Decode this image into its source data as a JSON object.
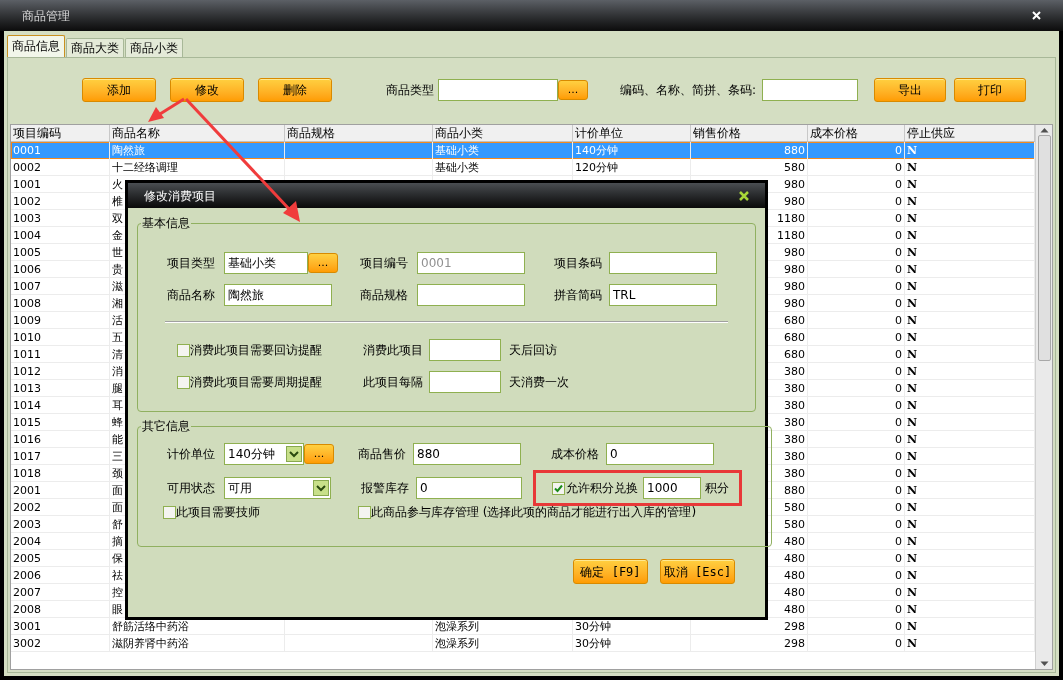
{
  "window": {
    "title": "商品管理"
  },
  "tabs": [
    {
      "label": "商品信息",
      "selected": true
    },
    {
      "label": "商品大类",
      "selected": false
    },
    {
      "label": "商品小类",
      "selected": false
    }
  ],
  "toolbar": {
    "buttons": [
      "添加",
      "修改",
      "删除"
    ],
    "type_label": "商品类型",
    "browse": "...",
    "search_label": "编码、名称、简拼、条码:",
    "right_buttons": [
      "导出",
      "打印"
    ]
  },
  "table": {
    "columns": [
      "项目编码",
      "商品名称",
      "商品规格",
      "商品小类",
      "计价单位",
      "销售价格",
      "成本价格",
      "停止供应"
    ],
    "rows": [
      {
        "code": "0001",
        "name": "陶然旅",
        "category": "基础小类",
        "unit": "140分钟",
        "price": "880",
        "cost": "0",
        "stop": "N",
        "selected": true
      },
      {
        "code": "0002",
        "name": "十二经络调理",
        "category": "基础小类",
        "unit": "120分钟",
        "price": "580",
        "cost": "0",
        "stop": "N",
        "selected": false
      },
      {
        "code": "1001",
        "name": "火",
        "price": "980",
        "cost": "0",
        "stop": "N",
        "selected": false
      },
      {
        "code": "1002",
        "name": "椎",
        "price": "980",
        "cost": "0",
        "stop": "N",
        "selected": false
      },
      {
        "code": "1003",
        "name": "双",
        "price": "1180",
        "cost": "0",
        "stop": "N",
        "selected": false
      },
      {
        "code": "1004",
        "name": "金",
        "price": "1180",
        "cost": "0",
        "stop": "N",
        "selected": false
      },
      {
        "code": "1005",
        "name": "世",
        "price": "980",
        "cost": "0",
        "stop": "N",
        "selected": false
      },
      {
        "code": "1006",
        "name": "贵",
        "price": "980",
        "cost": "0",
        "stop": "N",
        "selected": false
      },
      {
        "code": "1007",
        "name": "滋",
        "price": "980",
        "cost": "0",
        "stop": "N",
        "selected": false
      },
      {
        "code": "1008",
        "name": "湘",
        "price": "980",
        "cost": "0",
        "stop": "N",
        "selected": false
      },
      {
        "code": "1009",
        "name": "活",
        "price": "680",
        "cost": "0",
        "stop": "N",
        "selected": false
      },
      {
        "code": "1010",
        "name": "五",
        "price": "680",
        "cost": "0",
        "stop": "N",
        "selected": false
      },
      {
        "code": "1011",
        "name": "清",
        "price": "680",
        "cost": "0",
        "stop": "N",
        "selected": false
      },
      {
        "code": "1012",
        "name": "消",
        "price": "380",
        "cost": "0",
        "stop": "N",
        "selected": false
      },
      {
        "code": "1013",
        "name": "腿",
        "price": "380",
        "cost": "0",
        "stop": "N",
        "selected": false
      },
      {
        "code": "1014",
        "name": "耳",
        "price": "380",
        "cost": "0",
        "stop": "N",
        "selected": false
      },
      {
        "code": "1015",
        "name": "蜂",
        "price": "380",
        "cost": "0",
        "stop": "N",
        "selected": false
      },
      {
        "code": "1016",
        "name": "能",
        "price": "380",
        "cost": "0",
        "stop": "N",
        "selected": false
      },
      {
        "code": "1017",
        "name": "三",
        "price": "380",
        "cost": "0",
        "stop": "N",
        "selected": false
      },
      {
        "code": "1018",
        "name": "颈",
        "price": "380",
        "cost": "0",
        "stop": "N",
        "selected": false
      },
      {
        "code": "2001",
        "name": "面",
        "price": "880",
        "cost": "0",
        "stop": "N",
        "selected": false
      },
      {
        "code": "2002",
        "name": "面",
        "price": "580",
        "cost": "0",
        "stop": "N",
        "selected": false
      },
      {
        "code": "2003",
        "name": "舒",
        "price": "580",
        "cost": "0",
        "stop": "N",
        "selected": false
      },
      {
        "code": "2004",
        "name": "摘",
        "price": "480",
        "cost": "0",
        "stop": "N",
        "selected": false
      },
      {
        "code": "2005",
        "name": "保",
        "price": "480",
        "cost": "0",
        "stop": "N",
        "selected": false
      },
      {
        "code": "2006",
        "name": "祛",
        "price": "480",
        "cost": "0",
        "stop": "N",
        "selected": false
      },
      {
        "code": "2007",
        "name": "控",
        "price": "480",
        "cost": "0",
        "stop": "N",
        "selected": false
      },
      {
        "code": "2008",
        "name": "眼",
        "price": "480",
        "cost": "0",
        "stop": "N",
        "selected": false
      },
      {
        "code": "3001",
        "name": "舒筋活络中药浴",
        "category": "泡澡系列",
        "unit": "30分钟",
        "price": "298",
        "cost": "0",
        "stop": "N",
        "selected": false
      },
      {
        "code": "3002",
        "name": "滋阴养肾中药浴",
        "category": "泡澡系列",
        "unit": "30分钟",
        "price": "298",
        "cost": "0",
        "stop": "N",
        "selected": false
      }
    ]
  },
  "dialog": {
    "title": "修改消费项目",
    "basic": {
      "legend": "基本信息",
      "type": {
        "label": "项目类型",
        "value": "基础小类",
        "browse": "..."
      },
      "code": {
        "label": "项目编号",
        "value": "0001",
        "disabled": true
      },
      "barcode": {
        "label": "项目条码"
      },
      "name": {
        "label": "商品名称",
        "value": "陶然旅"
      },
      "spec": {
        "label": "商品规格"
      },
      "pinyin": {
        "label": "拼音简码",
        "value": "TRL"
      },
      "revisit": {
        "label": "消费此项目需要回访提醒",
        "checked": false,
        "prefix": "消费此项目",
        "suffix": "天后回访"
      },
      "cycle": {
        "label": "消费此项目需要周期提醒",
        "checked": false,
        "prefix": "此项目每隔",
        "suffix": "天消费一次"
      }
    },
    "other": {
      "legend": "其它信息",
      "unit": {
        "label": "计价单位",
        "value": "140分钟",
        "browse": "..."
      },
      "price": {
        "label": "商品售价",
        "value": "880"
      },
      "cost": {
        "label": "成本价格",
        "value": "0"
      },
      "status": {
        "label": "可用状态",
        "value": "可用"
      },
      "alarm": {
        "label": "报警库存",
        "value": "0"
      },
      "points": {
        "label": "允许积分兑换",
        "checked": true,
        "value": "1000",
        "suffix": "积分",
        "highlighted": true
      },
      "technician": {
        "label": "此项目需要技师",
        "checked": false
      },
      "stock": {
        "label": "此商品参与库存管理 (选择此项的商品才能进行出入库的管理)",
        "checked": false
      }
    },
    "buttons": [
      "确定 [F9]",
      "取消 [Esc]"
    ]
  }
}
